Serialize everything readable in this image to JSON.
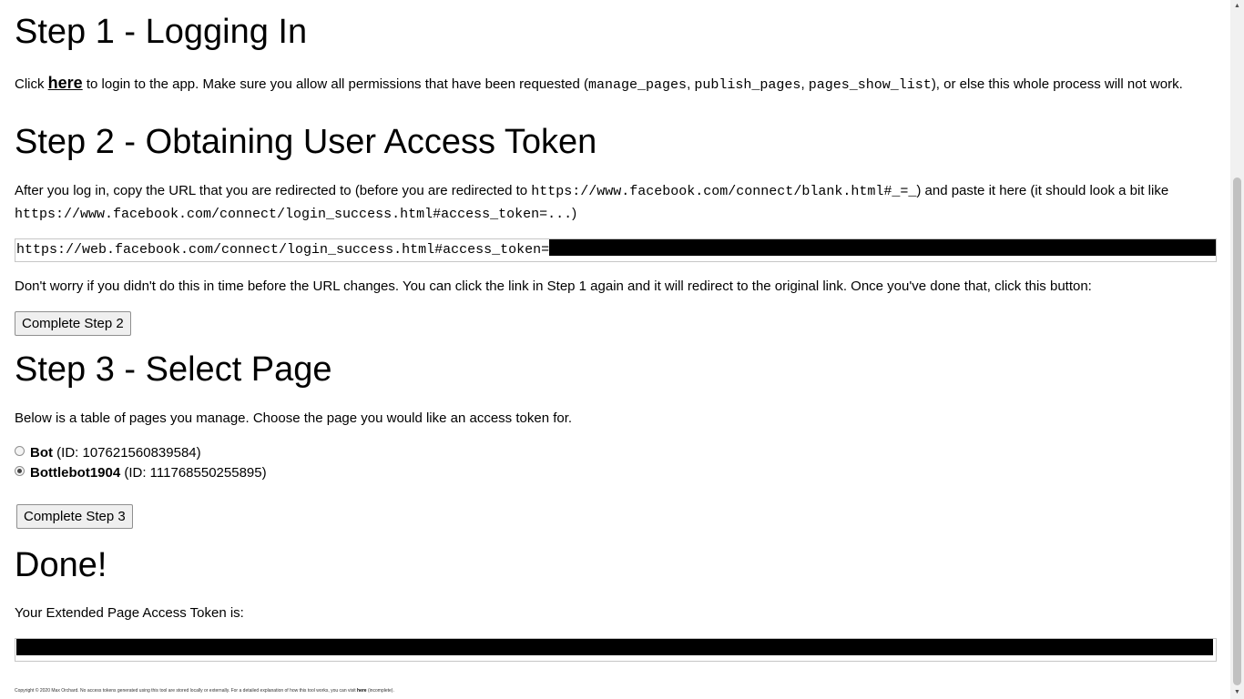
{
  "step1": {
    "heading": "Step 1 - Logging In",
    "text_before": "Click ",
    "link_label": "here",
    "text_after_link": " to login to the app. Make sure you allow all permissions that have been requested (",
    "perm1": "manage_pages",
    "sep1": ", ",
    "perm2": "publish_pages",
    "sep2": ", ",
    "perm3": "pages_show_list",
    "text_end": "), or else this whole process will not work."
  },
  "step2": {
    "heading": "Step 2 - Obtaining User Access Token",
    "intro_before": "After you log in, copy the URL that you are redirected to (before you are redirected to ",
    "blank_url": "https://www.facebook.com/connect/blank.html#_=_",
    "intro_mid": ") and paste it here (it should look a bit like",
    "example_url": "https://www.facebook.com/connect/login_success.html#access_token=...",
    "intro_end": ")",
    "input_value": "https://web.facebook.com/connect/login_success.html#access_token=",
    "note": "Don't worry if you didn't do this in time before the URL changes. You can click the link in Step 1 again and it will redirect to the original link. Once you've done that, click this button:",
    "button_label": "Complete Step 2"
  },
  "step3": {
    "heading": "Step 3 - Select Page",
    "intro": "Below is a table of pages you manage. Choose the page you would like an access token for.",
    "pages": [
      {
        "name": "Bot",
        "id_text": " (ID: 107621560839584)",
        "selected": false
      },
      {
        "name": "Bottlebot1904",
        "id_text": " (ID: 111768550255895)",
        "selected": true
      }
    ],
    "button_label": "Complete Step 3"
  },
  "done": {
    "heading": "Done!",
    "label": "Your Extended Page Access Token is:"
  },
  "footer": {
    "text_before": "Copyright © 2020 Max Orchard. No access tokens generated using this tool are stored locally or externally. For a detailed explanation of how this tool works, you can visit ",
    "link_label": "here",
    "text_after": " (incomplete)."
  },
  "colors": {
    "redaction": "#000000",
    "button_bg": "#efefef"
  }
}
